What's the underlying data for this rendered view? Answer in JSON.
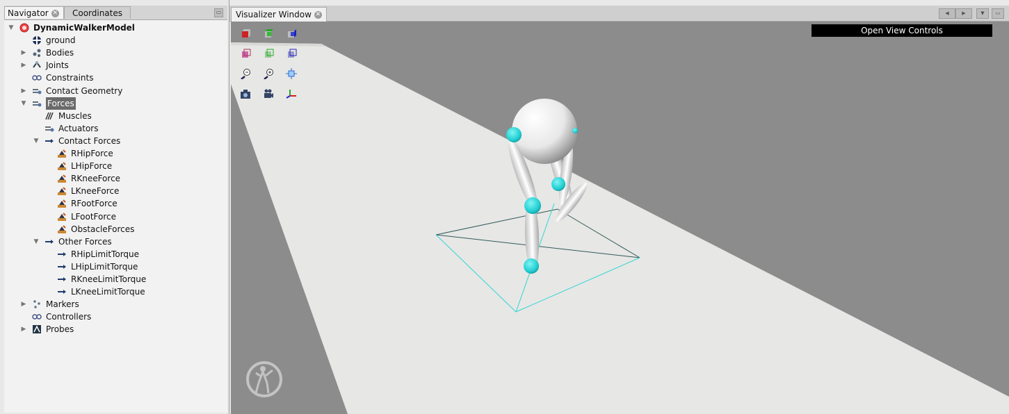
{
  "navigator": {
    "tabs": [
      "Navigator",
      "Coordinates"
    ],
    "tree": [
      {
        "label": "DynamicWalkerModel",
        "bold": true,
        "icon": "model-icon",
        "toggle": "▼"
      },
      {
        "label": "ground",
        "icon": "ground-icon",
        "toggle": ""
      },
      {
        "label": "Bodies",
        "icon": "bodies-icon",
        "toggle": "▶"
      },
      {
        "label": "Joints",
        "icon": "joints-icon",
        "toggle": "▶"
      },
      {
        "label": "Constraints",
        "icon": "constraints-icon",
        "toggle": ""
      },
      {
        "label": "Contact Geometry",
        "icon": "contact-geometry-icon",
        "toggle": "▶"
      },
      {
        "label": "Forces",
        "icon": "forces-icon",
        "toggle": "▼",
        "selected": true
      },
      {
        "label": "Muscles",
        "icon": "muscles-icon",
        "toggle": ""
      },
      {
        "label": "Actuators",
        "icon": "actuators-icon",
        "toggle": ""
      },
      {
        "label": "Contact Forces",
        "icon": "arrow-icon",
        "toggle": "▼"
      },
      {
        "label": "RHipForce",
        "icon": "contact-force-icon",
        "toggle": ""
      },
      {
        "label": "LHipForce",
        "icon": "contact-force-icon",
        "toggle": ""
      },
      {
        "label": "RKneeForce",
        "icon": "contact-force-icon",
        "toggle": ""
      },
      {
        "label": "LKneeForce",
        "icon": "contact-force-icon",
        "toggle": ""
      },
      {
        "label": "RFootForce",
        "icon": "contact-force-icon",
        "toggle": ""
      },
      {
        "label": "LFootForce",
        "icon": "contact-force-icon",
        "toggle": ""
      },
      {
        "label": "ObstacleForces",
        "icon": "contact-force-icon",
        "toggle": ""
      },
      {
        "label": "Other Forces",
        "icon": "arrow-icon",
        "toggle": "▼"
      },
      {
        "label": "RHipLimitTorque",
        "icon": "arrow-icon",
        "toggle": ""
      },
      {
        "label": "LHipLimitTorque",
        "icon": "arrow-icon",
        "toggle": ""
      },
      {
        "label": "RKneeLimitTorque",
        "icon": "arrow-icon",
        "toggle": ""
      },
      {
        "label": "LKneeLimitTorque",
        "icon": "arrow-icon",
        "toggle": ""
      },
      {
        "label": "Markers",
        "icon": "markers-icon",
        "toggle": "▶"
      },
      {
        "label": "Controllers",
        "icon": "controllers-icon",
        "toggle": ""
      },
      {
        "label": "Probes",
        "icon": "probes-icon",
        "toggle": "▶"
      }
    ]
  },
  "visualizer": {
    "tab_label": "Visualizer Window",
    "open_view_controls": "Open View Controls",
    "toolbar_icons": [
      "view-front-icon",
      "view-top-icon",
      "view-right-icon",
      "view-back-icon",
      "view-bottom-icon",
      "view-left-icon",
      "zoom-out-icon",
      "zoom-in-icon",
      "fit-view-icon",
      "snapshot-icon",
      "movie-icon",
      "axes-icon"
    ]
  },
  "colors": {
    "accent": "#6b6b6b",
    "marker": "#2fd6d6",
    "floor": "#e6e6e4",
    "background": "#8c8c8c"
  }
}
